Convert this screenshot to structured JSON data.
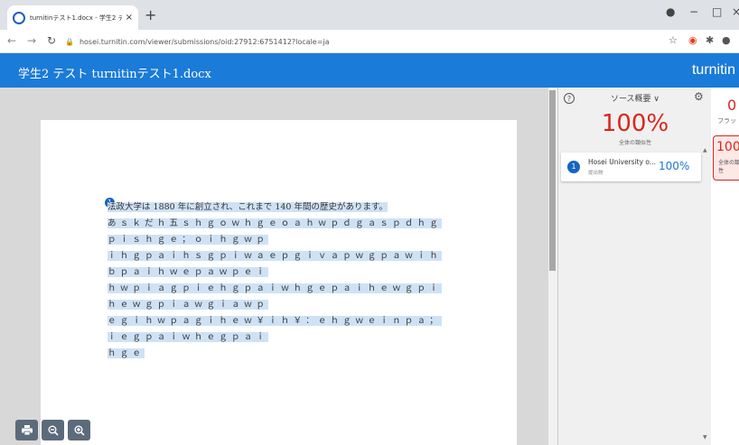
{
  "browser": {
    "tab_title": "turnitinテスト1.docx - 学生2 テスト",
    "tab_close": "×",
    "new_tab": "+",
    "url": "hosei.turnitin.com/viewer/submissions/oid:27912:6751412?locale=ja"
  },
  "header": {
    "doc_title": "学生2 テスト turnitinテスト1.docx",
    "brand": "turnitin"
  },
  "document": {
    "match_number": "1",
    "lines": [
      "法政大学は 1880 年に創立され、これまで 140 年間の歴史があります。",
      "あｓｋだｈ五ｓｈｇｏｗｈｇｅｏａｈｗｐｄｇａｓｐｄｈｇｐｉｓｈｇｅ；ｏｉｈｇｗｐ",
      "ｉｈｇｐａｉｈｓｇｐｉｗａｅｐｇｉｖａｐｗｇｐａｗｉｈｂｐａｉｈｗｅｐａｗｐｅｉ",
      "ｈｗｐｉａｇｐｉｅｈｇｐａｉｗｈｇｅｐａｉｈｅｗｇｐｉｈｅｗｇｐｉａｗｇｉａｗｐ",
      "ｅｇｉｈｗｐａｇｉｈｅｗ￥ｉｈ￥：ｅｈｇｗｅｉｎｐａ；ｉｅｇｐａｉｗｈｅｇｐａｉ",
      "ｈｇｅ"
    ]
  },
  "panel": {
    "help_icon": "?",
    "title": "ソース概要 ∨",
    "total_percent": "100%",
    "total_label": "全体の類似性",
    "sources": [
      {
        "number": "1",
        "name": "Hosei University o...",
        "type": "提出物",
        "percent": "100%"
      }
    ]
  },
  "side": {
    "flag_count": "0",
    "flag_label": "フラッ",
    "card_percent": "100",
    "card_label": "全体の類似性"
  },
  "colors": {
    "brand_blue": "#1b7bd8",
    "match_red": "#d9261c",
    "source_blue": "#1565c0"
  }
}
